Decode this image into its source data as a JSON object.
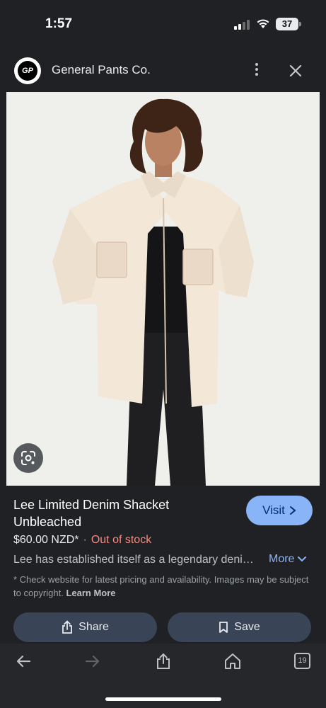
{
  "status_bar": {
    "time": "1:57",
    "battery": "37"
  },
  "header": {
    "site_name": "General Pants Co.",
    "logo_text": "GP"
  },
  "product": {
    "title": "Lee Limited Denim Shacket Unbleached",
    "visit_label": "Visit",
    "price": "$60.00 NZD*",
    "separator": "·",
    "stock_status": "Out of stock",
    "description": "Lee has established itself as a legendary deni…",
    "more_label": "More",
    "disclaimer": "* Check website for latest pricing and availability. Images may be subject to copyright.",
    "learn_more_label": "Learn More"
  },
  "actions": {
    "share_label": "Share",
    "save_label": "Save"
  },
  "toolbar": {
    "tabs_count": "19"
  },
  "colors": {
    "accent": "#8ab4f8",
    "stock_out": "#f28b82",
    "button_bg": "#394457",
    "background": "#202124"
  }
}
